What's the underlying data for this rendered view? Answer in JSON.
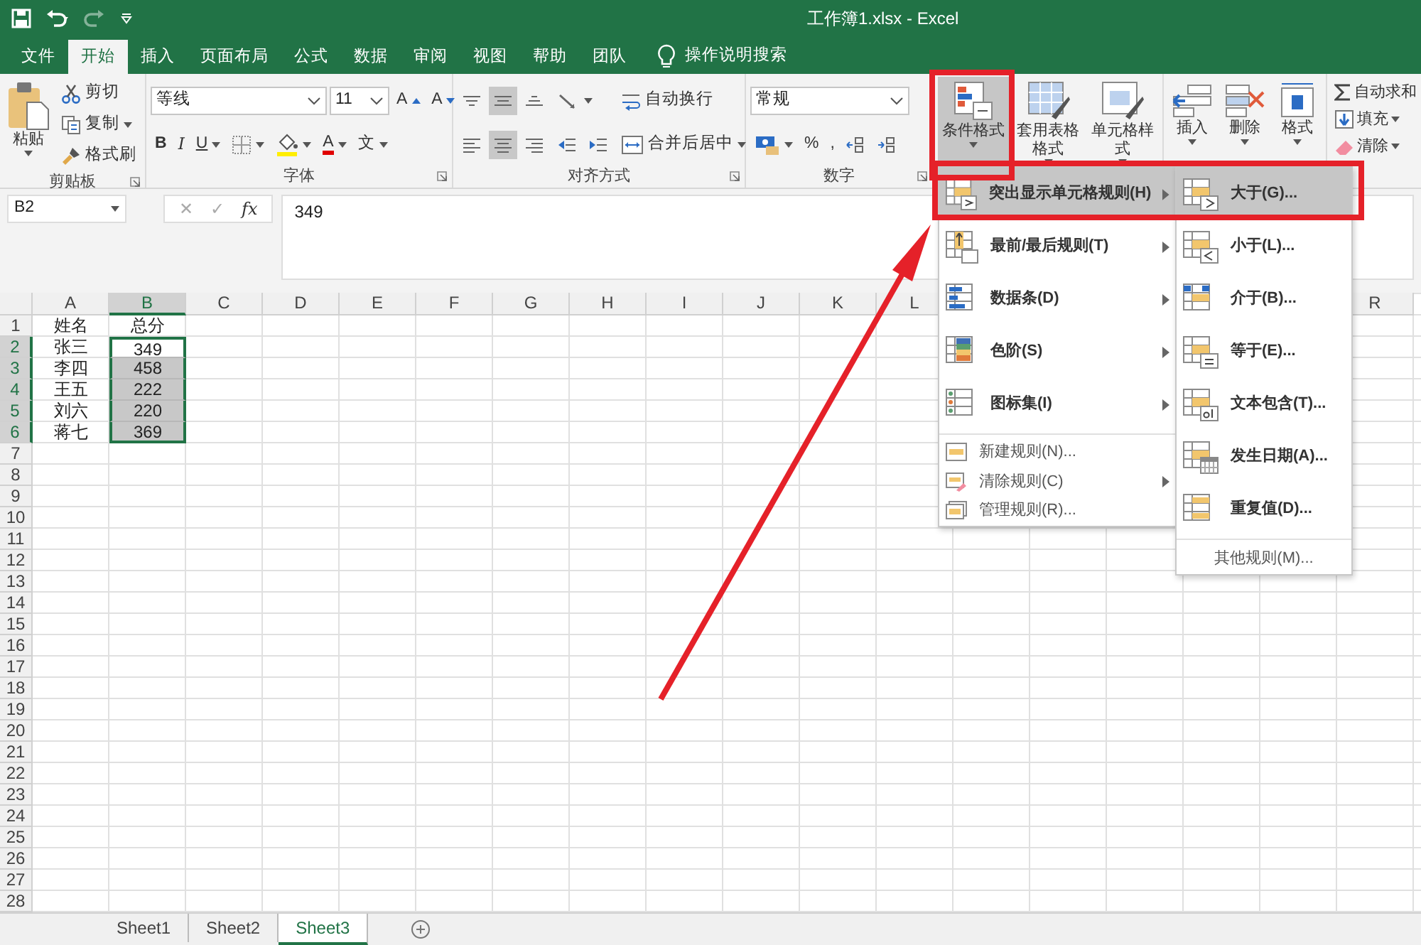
{
  "window": {
    "title": "工作簿1.xlsx - Excel"
  },
  "quick_access": [
    {
      "kind": "save",
      "disabled": false
    },
    {
      "kind": "undo",
      "disabled": false
    },
    {
      "kind": "redo",
      "disabled": true
    },
    {
      "kind": "customize",
      "disabled": false
    }
  ],
  "tabs": [
    {
      "label": "文件",
      "selected": false
    },
    {
      "label": "开始",
      "selected": true
    },
    {
      "label": "插入",
      "selected": false
    },
    {
      "label": "页面布局",
      "selected": false
    },
    {
      "label": "公式",
      "selected": false
    },
    {
      "label": "数据",
      "selected": false
    },
    {
      "label": "审阅",
      "selected": false
    },
    {
      "label": "视图",
      "selected": false
    },
    {
      "label": "帮助",
      "selected": false
    },
    {
      "label": "团队",
      "selected": false
    }
  ],
  "tell_me": {
    "label": "操作说明搜索"
  },
  "ribbon": {
    "groups": [
      {
        "label": "剪贴板",
        "columns": [
          {
            "kind": "paste",
            "label": "粘贴",
            "caret": true,
            "pressed": false
          },
          {
            "kind": "stack",
            "lines": [
              [
                {
                  "kind": "cut",
                  "label": "剪切",
                  "pressed": false
                }
              ],
              [
                {
                  "kind": "copy",
                  "label": "复制",
                  "caret": true,
                  "pressed": false
                }
              ],
              [
                {
                  "kind": "brush",
                  "label": "格式刷",
                  "pressed": false
                }
              ]
            ]
          }
        ]
      },
      {
        "label": "字体",
        "columns": [
          {
            "kind": "stack",
            "lines": [
              [
                {
                  "kind": "field",
                  "value": "等线"
                },
                {
                  "kind": "field",
                  "value": "11"
                },
                {
                  "kind": "grow",
                  "label": "A",
                  "pressed": false
                },
                {
                  "kind": "shrink",
                  "label": "A",
                  "pressed": false
                }
              ],
              [
                {
                  "kind": "bold",
                  "label": "B",
                  "pressed": false
                },
                {
                  "kind": "italic",
                  "label": "I",
                  "pressed": false
                },
                {
                  "kind": "underline",
                  "label": "U",
                  "caret": true,
                  "pressed": false
                },
                {
                  "kind": "border",
                  "caret": true,
                  "pressed": false
                },
                {
                  "kind": "fill",
                  "caret": true,
                  "pressed": false
                },
                {
                  "kind": "font-color",
                  "label": "A",
                  "caret": true,
                  "pressed": false
                },
                {
                  "kind": "phonetic",
                  "label": "文",
                  "caret": true,
                  "pressed": false
                }
              ]
            ]
          }
        ]
      },
      {
        "label": "对齐方式",
        "columns": [
          {
            "kind": "stack",
            "lines": [
              [
                {
                  "kind": "align-top",
                  "pressed": false
                },
                {
                  "kind": "align-middle",
                  "pressed": true
                },
                {
                  "kind": "align-bottom",
                  "pressed": false
                }
              ],
              [
                {
                  "kind": "align-left",
                  "pressed": false
                },
                {
                  "kind": "align-center",
                  "pressed": true
                },
                {
                  "kind": "align-right",
                  "pressed": false
                }
              ]
            ]
          },
          {
            "kind": "stack",
            "lines": [
              [
                {
                  "kind": "orientation",
                  "caret": true,
                  "pressed": false
                }
              ],
              [
                {
                  "kind": "indent-decrease",
                  "pressed": false
                },
                {
                  "kind": "indent-increase",
                  "pressed": false
                }
              ]
            ]
          },
          {
            "kind": "stack",
            "lines": [
              [
                {
                  "kind": "wrap",
                  "label": "自动换行",
                  "pressed": false
                }
              ],
              [
                {
                  "kind": "merge",
                  "label": "合并后居中",
                  "caret": true,
                  "pressed": false
                }
              ]
            ]
          }
        ]
      },
      {
        "label": "数字",
        "columns": [
          {
            "kind": "stack",
            "lines": [
              [
                {
                  "kind": "field",
                  "value": "常规"
                }
              ],
              [
                {
                  "kind": "currency",
                  "caret": true,
                  "pressed": false
                },
                {
                  "kind": "percent",
                  "label": "%",
                  "pressed": false
                },
                {
                  "kind": "comma",
                  "label": ",",
                  "pressed": false
                },
                {
                  "kind": "decimal-increase",
                  "pressed": false
                },
                {
                  "kind": "decimal-decrease",
                  "pressed": false
                }
              ]
            ]
          }
        ]
      },
      {
        "columns": [
          {
            "kind": "conditional",
            "label": "条件格式",
            "caret": true,
            "pressed": true
          },
          {
            "kind": "table-format",
            "label": "套用表格格式",
            "caret": true,
            "pressed": false
          },
          {
            "kind": "cell-style",
            "label": "单元格样式",
            "caret": true,
            "pressed": false
          }
        ]
      },
      {
        "columns": [
          {
            "kind": "insert",
            "label": "插入",
            "caret": true,
            "pressed": false
          },
          {
            "kind": "delete",
            "label": "删除",
            "caret": true,
            "pressed": false
          },
          {
            "kind": "format",
            "label": "格式",
            "caret": true,
            "pressed": false
          }
        ]
      },
      {
        "columns": [
          {
            "kind": "stack",
            "lines": [
              [
                {
                  "kind": "sum",
                  "label": "自动求和",
                  "pressed": false
                }
              ],
              [
                {
                  "kind": "fill-down",
                  "label": "填充",
                  "caret": true,
                  "pressed": false
                }
              ],
              [
                {
                  "kind": "clear",
                  "label": "清除",
                  "caret": true,
                  "pressed": false
                }
              ]
            ]
          }
        ]
      }
    ]
  },
  "formula_bar": {
    "name_box": "B2",
    "buttons": [
      {
        "label": "✕",
        "disabled": true
      },
      {
        "label": "✓",
        "disabled": true
      },
      {
        "label": "fx",
        "disabled": false
      }
    ],
    "formula": "349"
  },
  "sheet": {
    "columns": [
      {
        "label": "A",
        "selected": false
      },
      {
        "label": "B",
        "selected": true
      },
      {
        "label": "C",
        "selected": false
      },
      {
        "label": "D",
        "selected": false
      },
      {
        "label": "E",
        "selected": false
      },
      {
        "label": "F",
        "selected": false
      },
      {
        "label": "G",
        "selected": false
      },
      {
        "label": "H",
        "selected": false
      },
      {
        "label": "I",
        "selected": false
      },
      {
        "label": "J",
        "selected": false
      },
      {
        "label": "K",
        "selected": false
      },
      {
        "label": "L",
        "selected": false
      }
    ],
    "last_column": {
      "label": "R",
      "selected": false
    },
    "rows": [
      {
        "label": "1",
        "selected": false,
        "cells": [
          {
            "value": "姓名",
            "selected": false,
            "active": false
          },
          {
            "value": "总分",
            "selected": false,
            "active": false
          }
        ]
      },
      {
        "label": "2",
        "selected": true,
        "cells": [
          {
            "value": "张三",
            "selected": false,
            "active": false
          },
          {
            "value": "349",
            "selected": true,
            "active": true
          }
        ]
      },
      {
        "label": "3",
        "selected": true,
        "cells": [
          {
            "value": "李四",
            "selected": false,
            "active": false
          },
          {
            "value": "458",
            "selected": true,
            "active": false
          }
        ]
      },
      {
        "label": "4",
        "selected": true,
        "cells": [
          {
            "value": "王五",
            "selected": false,
            "active": false
          },
          {
            "value": "222",
            "selected": true,
            "active": false
          }
        ]
      },
      {
        "label": "5",
        "selected": true,
        "cells": [
          {
            "value": "刘六",
            "selected": false,
            "active": false
          },
          {
            "value": "220",
            "selected": true,
            "active": false
          }
        ]
      },
      {
        "label": "6",
        "selected": true,
        "cells": [
          {
            "value": "蒋七",
            "selected": false,
            "active": false
          },
          {
            "value": "369",
            "selected": true,
            "active": false
          }
        ]
      },
      {
        "label": "7",
        "selected": false
      },
      {
        "label": "8",
        "selected": false
      },
      {
        "label": "9",
        "selected": false
      },
      {
        "label": "10",
        "selected": false
      },
      {
        "label": "11",
        "selected": false
      },
      {
        "label": "12",
        "selected": false
      },
      {
        "label": "13",
        "selected": false
      },
      {
        "label": "14",
        "selected": false
      },
      {
        "label": "15",
        "selected": false
      },
      {
        "label": "16",
        "selected": false
      },
      {
        "label": "17",
        "selected": false
      },
      {
        "label": "18",
        "selected": false
      },
      {
        "label": "19",
        "selected": false
      },
      {
        "label": "20",
        "selected": false
      },
      {
        "label": "21",
        "selected": false
      },
      {
        "label": "22",
        "selected": false
      },
      {
        "label": "23",
        "selected": false
      },
      {
        "label": "24",
        "selected": false
      },
      {
        "label": "25",
        "selected": false
      },
      {
        "label": "26",
        "selected": false
      },
      {
        "label": "27",
        "selected": false
      },
      {
        "label": "28",
        "selected": false
      }
    ]
  },
  "sheet_tabs": [
    {
      "label": "Sheet1",
      "selected": false
    },
    {
      "label": "Sheet2",
      "selected": false
    },
    {
      "label": "Sheet3",
      "selected": true
    }
  ],
  "menu": {
    "sections": [
      {
        "kind": "large",
        "items": [
          {
            "kind": "highlight",
            "label": "突出显示单元格规则(H)",
            "submenu": true,
            "selected": true
          },
          {
            "kind": "top-bottom",
            "label": "最前/最后规则(T)",
            "submenu": true,
            "selected": false
          },
          {
            "kind": "data-bar",
            "label": "数据条(D)",
            "submenu": true,
            "selected": false
          },
          {
            "kind": "color-scale",
            "label": "色阶(S)",
            "submenu": true,
            "selected": false
          },
          {
            "kind": "icon-set",
            "label": "图标集(I)",
            "submenu": true,
            "selected": false
          }
        ]
      },
      {
        "kind": "small",
        "items": [
          {
            "kind": "new-rule",
            "label": "新建规则(N)...",
            "submenu": false,
            "selected": false
          },
          {
            "kind": "clear-rule",
            "label": "清除规则(C)",
            "submenu": true,
            "selected": false
          },
          {
            "kind": "manage-rule",
            "label": "管理规则(R)...",
            "submenu": false,
            "selected": false
          }
        ]
      }
    ]
  },
  "submenu": {
    "sections": [
      {
        "kind": "large",
        "items": [
          {
            "kind": "greater",
            "label": "大于(G)...",
            "selected": true
          },
          {
            "kind": "less",
            "label": "小于(L)...",
            "selected": false
          },
          {
            "kind": "between",
            "label": "介于(B)...",
            "selected": false
          },
          {
            "kind": "equal",
            "label": "等于(E)...",
            "selected": false
          },
          {
            "kind": "text",
            "label": "文本包含(T)...",
            "selected": false
          },
          {
            "kind": "date",
            "label": "发生日期(A)...",
            "selected": false
          },
          {
            "kind": "duplicate",
            "label": "重复值(D)...",
            "selected": false
          }
        ]
      },
      {
        "kind": "plain",
        "items": [
          {
            "label": "其他规则(M)...",
            "selected": false
          }
        ]
      }
    ]
  }
}
